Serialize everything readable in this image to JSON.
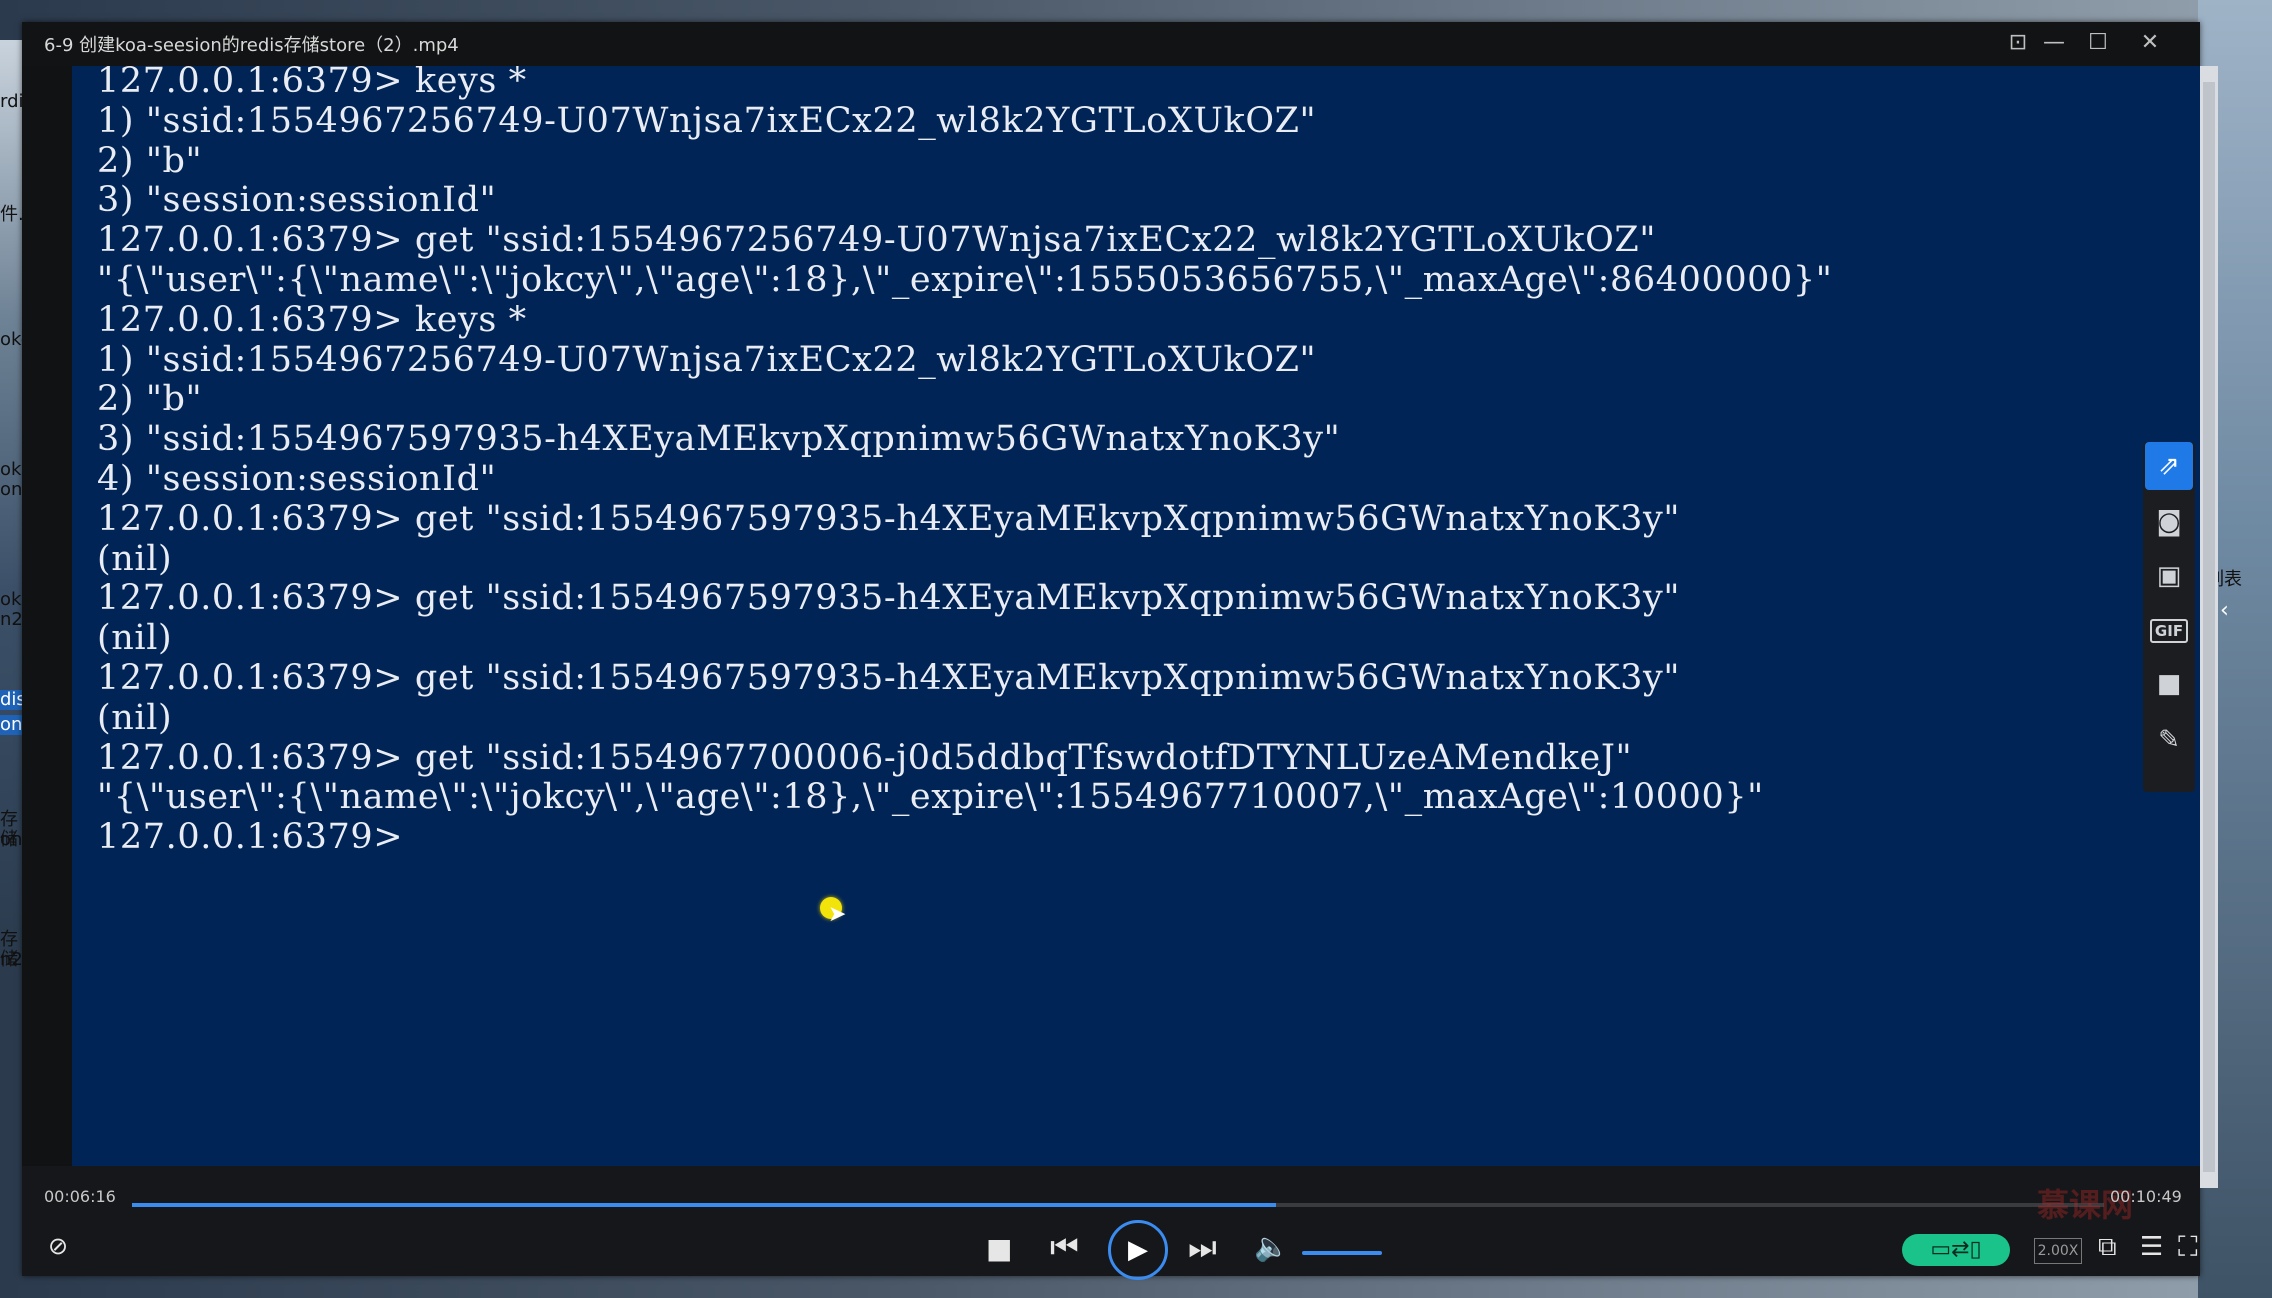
{
  "player": {
    "title": "6-9 创建koa-seesion的redis存储store（2）.mp4",
    "window_buttons": [
      "pin-icon",
      "minimize-icon",
      "maximize-icon",
      "close-icon"
    ]
  },
  "terminal": {
    "background": "#012456",
    "lines": [
      "127.0.0.1:6379> keys *",
      "1) \"ssid:1554967256749-U07Wnjsa7ixECx22_wl8k2YGTLoXUkOZ\"",
      "2) \"b\"",
      "3) \"session:sessionId\"",
      "127.0.0.1:6379> get \"ssid:1554967256749-U07Wnjsa7ixECx22_wl8k2YGTLoXUkOZ\"",
      "\"{\\\"user\\\":{\\\"name\\\":\\\"jokcy\\\",\\\"age\\\":18},\\\"_expire\\\":1555053656755,\\\"_maxAge\\\":86400000}\"",
      "127.0.0.1:6379> keys *",
      "1) \"ssid:1554967256749-U07Wnjsa7ixECx22_wl8k2YGTLoXUkOZ\"",
      "2) \"b\"",
      "3) \"ssid:1554967597935-h4XEyaMEkvpXqpnimw56GWnatxYnoK3y\"",
      "4) \"session:sessionId\"",
      "127.0.0.1:6379> get \"ssid:1554967597935-h4XEyaMEkvpXqpnimw56GWnatxYnoK3y\"",
      "(nil)",
      "127.0.0.1:6379> get \"ssid:1554967597935-h4XEyaMEkvpXqpnimw56GWnatxYnoK3y\"",
      "(nil)",
      "127.0.0.1:6379> get \"ssid:1554967597935-h4XEyaMEkvpXqpnimw56GWnatxYnoK3y\"",
      "(nil)",
      "127.0.0.1:6379> get \"ssid:1554967700006-j0d5ddbqTfswdotfDTYNLUzeAMendkeJ\"",
      "\"{\\\"user\\\":{\\\"name\\\":\\\"jokcy\\\",\\\"age\\\":18},\\\"_expire\\\":1554967710007,\\\"_maxAge\\\":10000}\"",
      "127.0.0.1:6379> "
    ]
  },
  "side_toolbar": {
    "buttons": [
      "share-icon",
      "camera-icon",
      "gallery-icon",
      "gif-icon",
      "video-record-icon",
      "pen-icon"
    ],
    "gif_label": "GIF"
  },
  "controls": {
    "elapsed": "00:06:16",
    "total": "00:10:49",
    "progress": 0.58,
    "speed": "2.00X",
    "accent": "#3b8cf0",
    "toggle_color": "#19c38a"
  },
  "desktop": {
    "right_label": "列表"
  }
}
